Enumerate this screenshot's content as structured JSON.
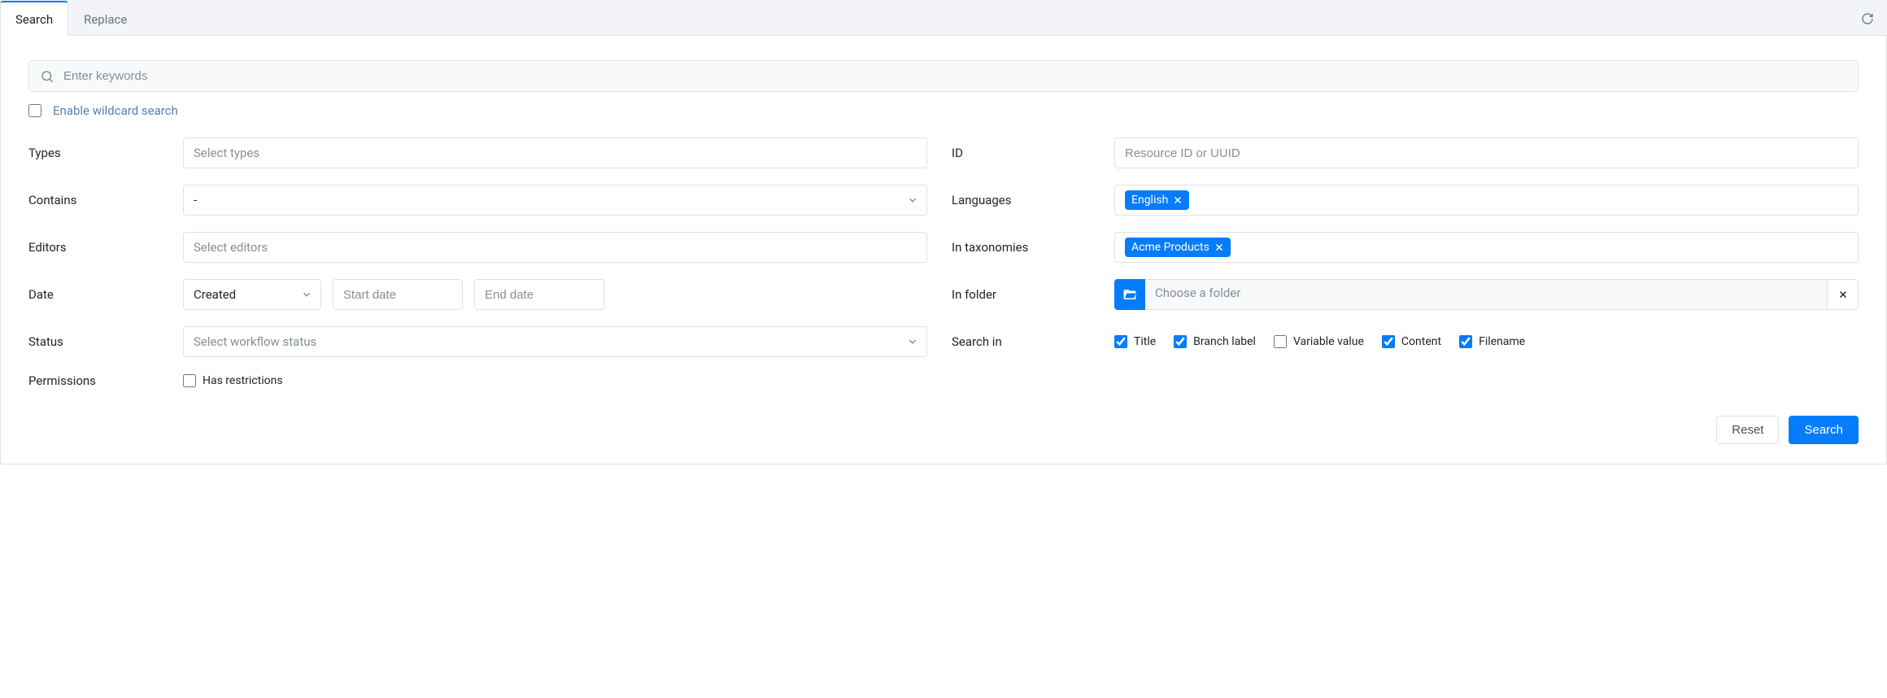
{
  "tabs": {
    "search": "Search",
    "replace": "Replace"
  },
  "keywords_placeholder": "Enter keywords",
  "wildcard": {
    "checked": false,
    "label": "Enable wildcard search"
  },
  "labels": {
    "types": "Types",
    "id": "ID",
    "contains": "Contains",
    "languages": "Languages",
    "editors": "Editors",
    "in_taxonomies": "In taxonomies",
    "date": "Date",
    "in_folder": "In folder",
    "status": "Status",
    "search_in": "Search in",
    "permissions": "Permissions"
  },
  "fields": {
    "types_placeholder": "Select types",
    "id_placeholder": "Resource ID or UUID",
    "contains_selected": "-",
    "editors_placeholder": "Select editors",
    "status_placeholder": "Select workflow status",
    "date_type": "Created",
    "start_placeholder": "Start date",
    "end_placeholder": "End date",
    "folder_placeholder": "Choose a folder",
    "language_tag": "English",
    "taxonomy_tag": "Acme Products",
    "permissions_label": "Has restrictions",
    "permissions_checked": false
  },
  "search_in": {
    "title": {
      "label": "Title",
      "checked": true
    },
    "branch": {
      "label": "Branch label",
      "checked": true
    },
    "variable": {
      "label": "Variable value",
      "checked": false
    },
    "content": {
      "label": "Content",
      "checked": true
    },
    "filename": {
      "label": "Filename",
      "checked": true
    }
  },
  "buttons": {
    "reset": "Reset",
    "search": "Search"
  }
}
